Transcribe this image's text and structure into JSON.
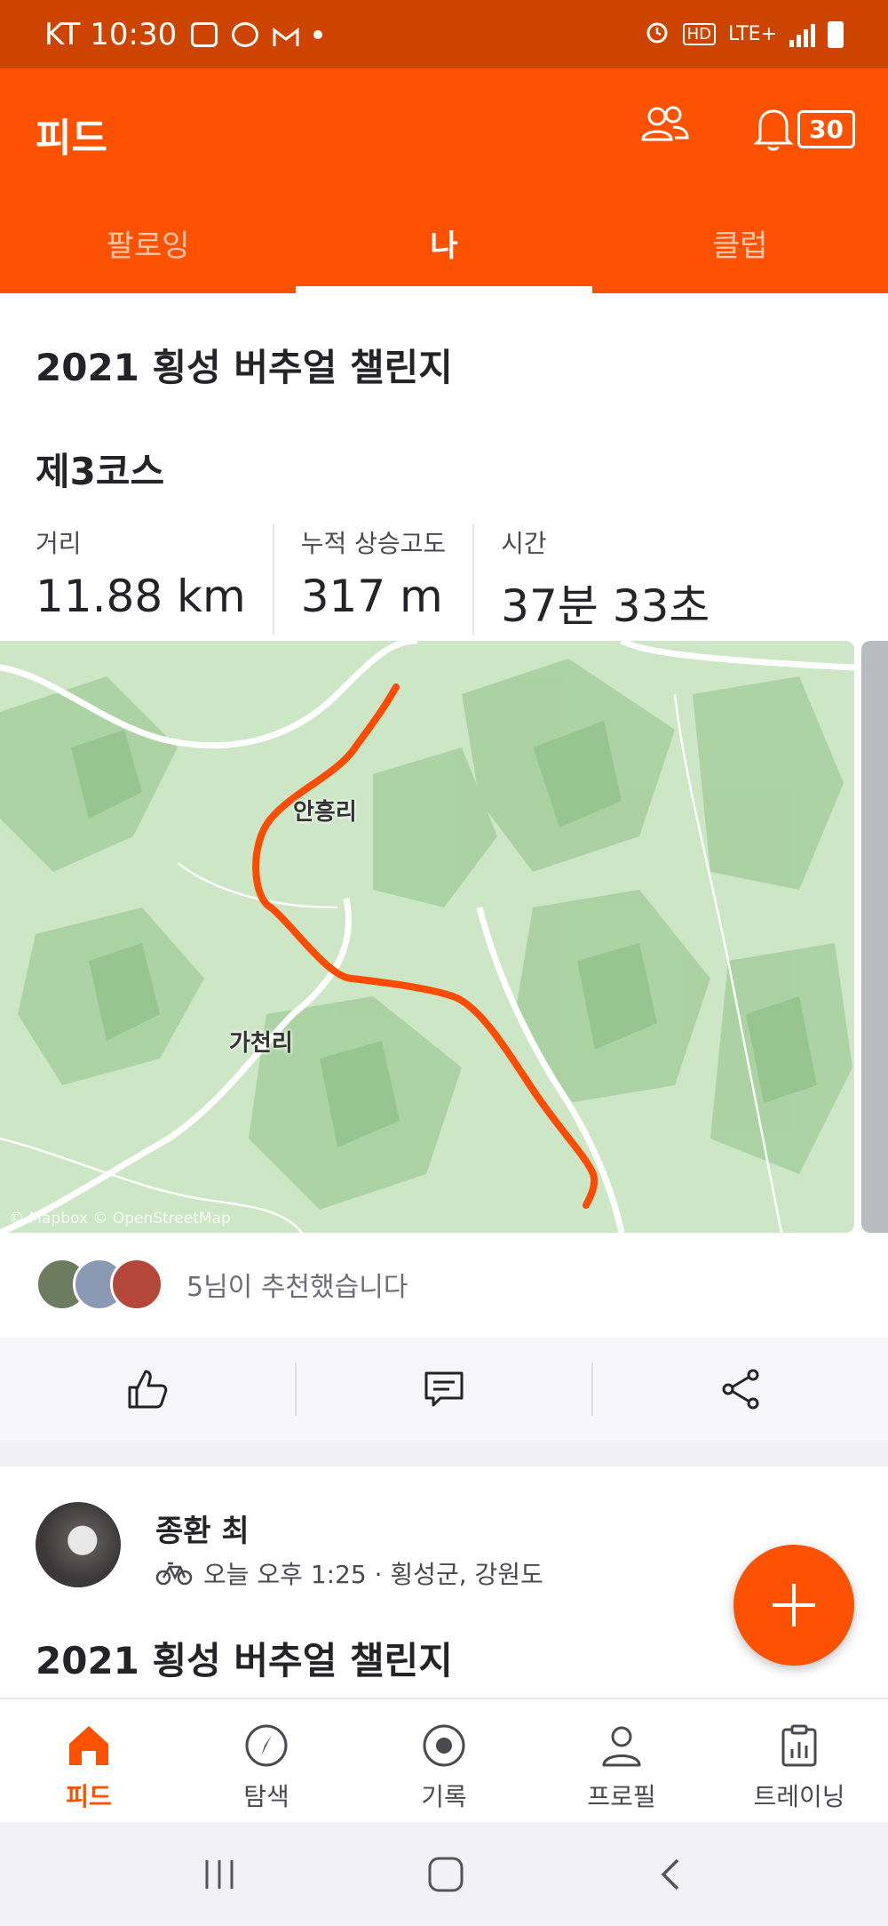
{
  "status_bar": {
    "carrier_time": "KT 10:30",
    "network": "LTE+"
  },
  "header": {
    "title": "피드",
    "notification_count": "30",
    "tabs": [
      {
        "label": "팔로잉"
      },
      {
        "label": "나"
      },
      {
        "label": "클럽"
      }
    ],
    "active_tab": "나"
  },
  "post": {
    "title": "2021 횡성 버추얼 챌린지",
    "course": "제3코스",
    "stats": [
      {
        "label": "거리",
        "value": "11.88 km"
      },
      {
        "label": "누적 상승고도",
        "value": "317 m"
      },
      {
        "label": "시간",
        "value": "37분 33초"
      }
    ],
    "map": {
      "labels": [
        "안흥리",
        "가천리"
      ],
      "attribution": "© Mapbox © OpenStreetMap",
      "route_color": "#fc5200"
    },
    "kudos_text": "5님이 추천했습니다",
    "actions": [
      "kudos",
      "comment",
      "share"
    ]
  },
  "next_post": {
    "author": "종환 최",
    "meta": "오늘 오후 1:25 · 횡성군, 강원도",
    "title": "2021 횡성 버추얼 챌린지"
  },
  "bottom_nav": [
    {
      "label": "피드",
      "icon": "home-icon",
      "active": true
    },
    {
      "label": "탐색",
      "icon": "compass-icon",
      "active": false
    },
    {
      "label": "기록",
      "icon": "record-icon",
      "active": false
    },
    {
      "label": "프로필",
      "icon": "profile-icon",
      "active": false
    },
    {
      "label": "트레이닝",
      "icon": "training-icon",
      "active": false
    }
  ],
  "colors": {
    "brand": "#fc5200",
    "status_bar": "#cc4400"
  }
}
